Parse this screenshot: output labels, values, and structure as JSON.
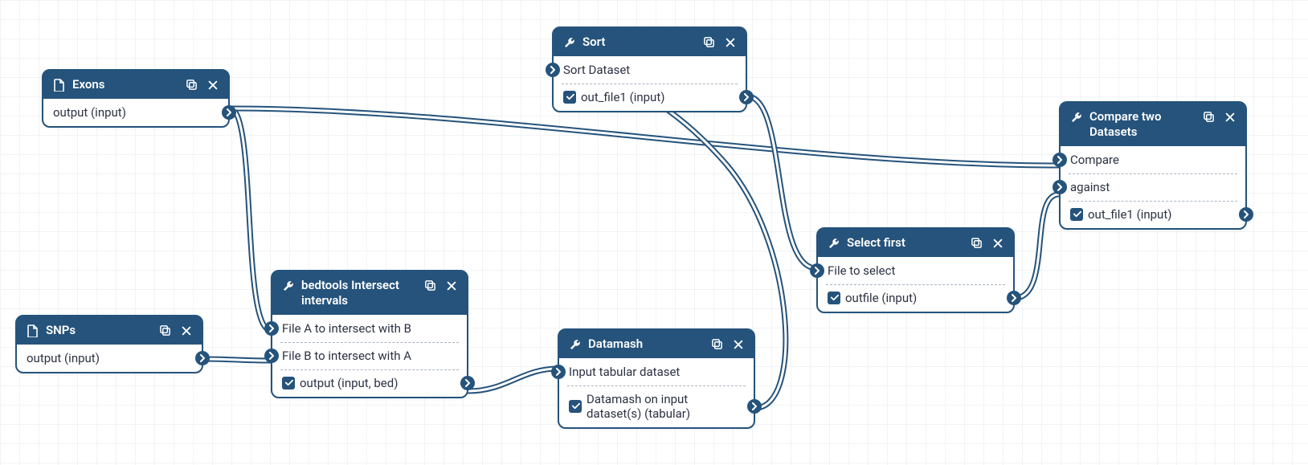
{
  "nodes": {
    "exons": {
      "type": "input",
      "title": "Exons",
      "outputs": [
        {
          "label": "output (input)"
        }
      ]
    },
    "snps": {
      "type": "input",
      "title": "SNPs",
      "outputs": [
        {
          "label": "output (input)"
        }
      ]
    },
    "bedtools": {
      "type": "tool",
      "title": "bedtools Intersect intervals",
      "inputs": [
        {
          "label": "File A to intersect with B"
        },
        {
          "label": "File B to intersect with A"
        }
      ],
      "outputs": [
        {
          "label": "output (input, bed)"
        }
      ]
    },
    "datamash": {
      "type": "tool",
      "title": "Datamash",
      "inputs": [
        {
          "label": "Input tabular dataset"
        }
      ],
      "outputs": [
        {
          "label": "Datamash on input dataset(s) (tabular)"
        }
      ]
    },
    "sort": {
      "type": "tool",
      "title": "Sort",
      "inputs": [
        {
          "label": "Sort Dataset"
        }
      ],
      "outputs": [
        {
          "label": "out_file1 (input)"
        }
      ]
    },
    "select_first": {
      "type": "tool",
      "title": "Select first",
      "inputs": [
        {
          "label": "File to select"
        }
      ],
      "outputs": [
        {
          "label": "outfile (input)"
        }
      ]
    },
    "compare": {
      "type": "tool",
      "title": "Compare two Datasets",
      "inputs": [
        {
          "label": "Compare"
        },
        {
          "label": "against"
        }
      ],
      "outputs": [
        {
          "label": "out_file1 (input)"
        }
      ]
    }
  },
  "connections": [
    {
      "from": "exons.output",
      "to": "bedtools.fileA"
    },
    {
      "from": "snps.output",
      "to": "bedtools.fileB"
    },
    {
      "from": "bedtools.output",
      "to": "datamash.input"
    },
    {
      "from": "datamash.output",
      "to": "sort.input"
    },
    {
      "from": "sort.output",
      "to": "select_first.input"
    },
    {
      "from": "select_first.output",
      "to": "compare.against"
    },
    {
      "from": "exons.output",
      "to": "compare.compare"
    }
  ],
  "icons": {
    "file": "file-icon",
    "tool": "wrench-icon",
    "copy": "clone-icon",
    "close": "close-icon",
    "check": "check-icon",
    "chevron": "chevron-right-icon"
  },
  "colors": {
    "accent": "#25537b"
  }
}
